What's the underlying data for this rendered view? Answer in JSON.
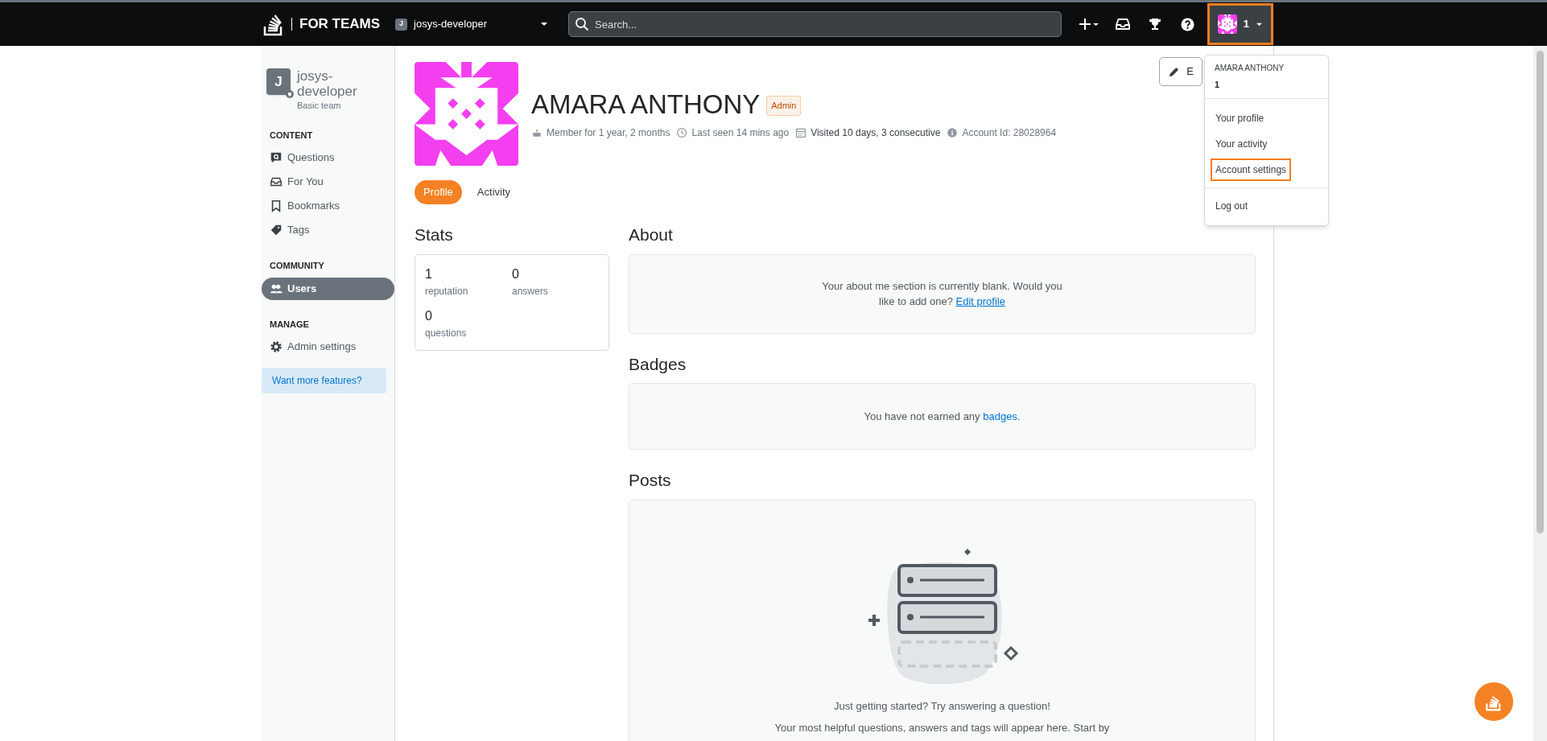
{
  "topbar": {
    "brand": "FOR TEAMS",
    "team": {
      "initial": "J",
      "name": "josys-developer"
    },
    "search": {
      "placeholder": "Search..."
    },
    "user": {
      "reputation": "1",
      "highlighted": true
    }
  },
  "user_menu": {
    "name": "AMARA ANTHONY",
    "reputation": "1",
    "items": [
      {
        "label": "Your profile",
        "highlighted": false
      },
      {
        "label": "Your activity",
        "highlighted": false
      },
      {
        "label": "Account settings",
        "highlighted": true
      }
    ],
    "footer_items": [
      {
        "label": "Log out",
        "highlighted": false
      }
    ]
  },
  "sidebar": {
    "team": {
      "initial": "J",
      "name": "josys-developer",
      "plan": "Basic team"
    },
    "sections": [
      {
        "title": "CONTENT",
        "items": [
          {
            "label": "Questions",
            "kind": "question",
            "selected": false
          },
          {
            "label": "For You",
            "kind": "inbox",
            "selected": false
          },
          {
            "label": "Bookmarks",
            "kind": "bookmark",
            "selected": false
          },
          {
            "label": "Tags",
            "kind": "tag",
            "selected": false
          }
        ]
      },
      {
        "title": "COMMUNITY",
        "items": [
          {
            "label": "Users",
            "kind": "users",
            "selected": true
          }
        ]
      },
      {
        "title": "MANAGE",
        "items": [
          {
            "label": "Admin settings",
            "kind": "gear",
            "selected": false
          }
        ]
      }
    ],
    "promo": "Want more features?"
  },
  "profile": {
    "name": "AMARA ANTHONY",
    "badge": "Admin",
    "edit_button": "E",
    "meta": [
      {
        "kind": "cake",
        "text": "Member for 1 year, 2 months"
      },
      {
        "kind": "clock",
        "text": "Last seen 14 mins ago"
      },
      {
        "kind": "calendar",
        "text": "Visited 10 days, 3 consecutive"
      },
      {
        "kind": "info",
        "text": "Account Id: 28028964"
      }
    ],
    "tabs": [
      {
        "label": "Profile",
        "selected": true
      },
      {
        "label": "Activity",
        "selected": false
      }
    ]
  },
  "stats": {
    "title": "Stats",
    "items": [
      {
        "value": "1",
        "label": "reputation"
      },
      {
        "value": "0",
        "label": "answers"
      },
      {
        "value": "0",
        "label": "questions"
      }
    ]
  },
  "about": {
    "title": "About",
    "text": "Your about me section is currently blank. Would you like to add one?",
    "link": "Edit profile"
  },
  "badges": {
    "title": "Badges",
    "text": "You have not earned any",
    "link": "badges",
    "after": "."
  },
  "posts": {
    "title": "Posts",
    "lines": [
      "Just getting started? Try answering a question!",
      "Your most helpful questions, answers and tags will appear here. Start by"
    ]
  }
}
